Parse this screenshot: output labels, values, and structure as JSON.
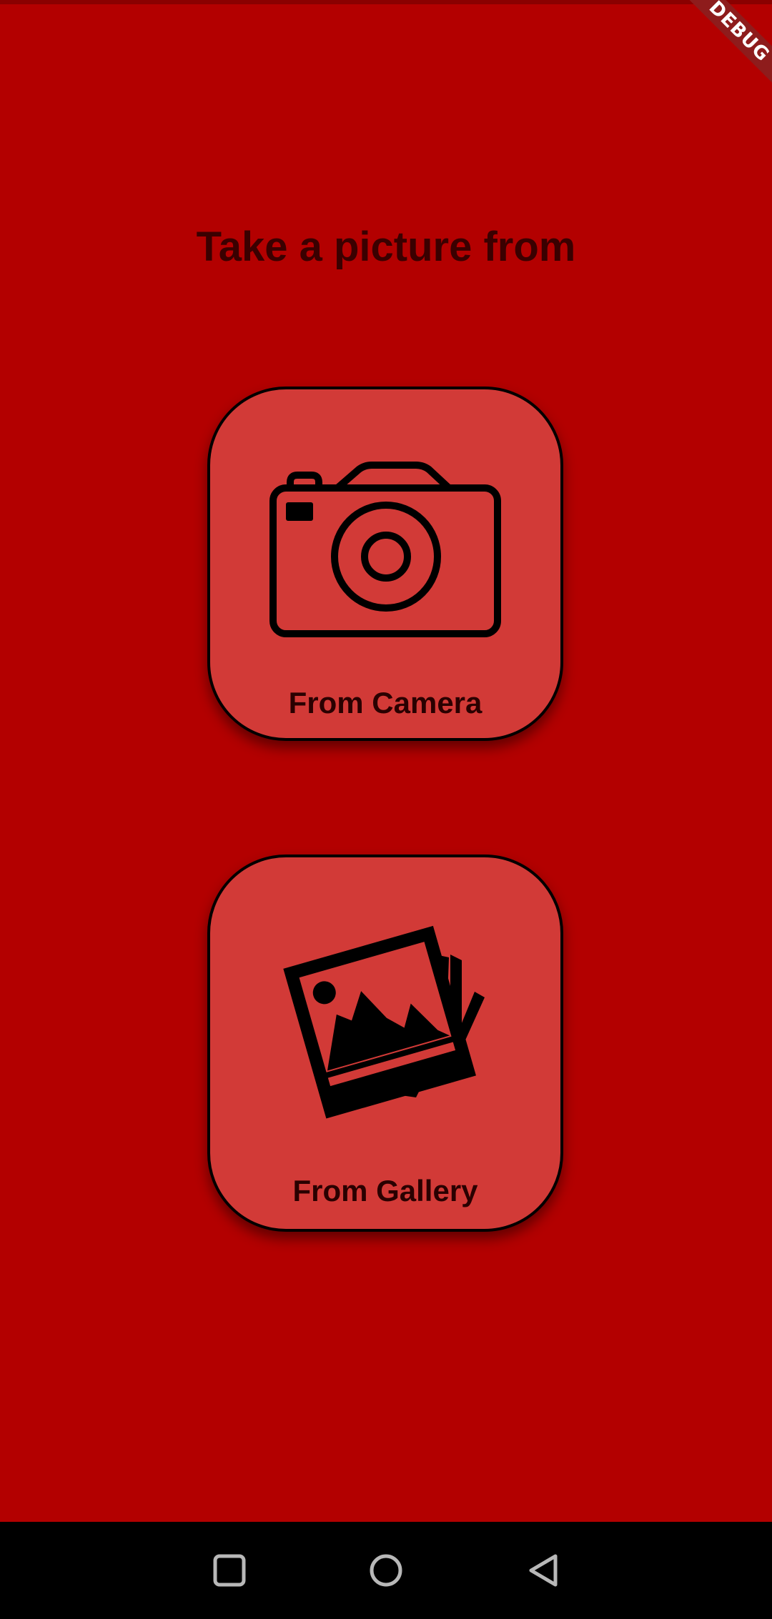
{
  "debug_banner": "DEBUG",
  "title": "Take a picture from",
  "options": [
    {
      "label": "From Camera",
      "icon": "camera-icon"
    },
    {
      "label": "From Gallery",
      "icon": "gallery-icon"
    }
  ],
  "nav_bar": {
    "buttons": [
      "recents-icon",
      "home-icon",
      "back-icon"
    ]
  },
  "colors": {
    "background": "#b30000",
    "card": "#d23a37",
    "nav_bar": "#000000",
    "nav_icons": "#b8b8b8"
  }
}
